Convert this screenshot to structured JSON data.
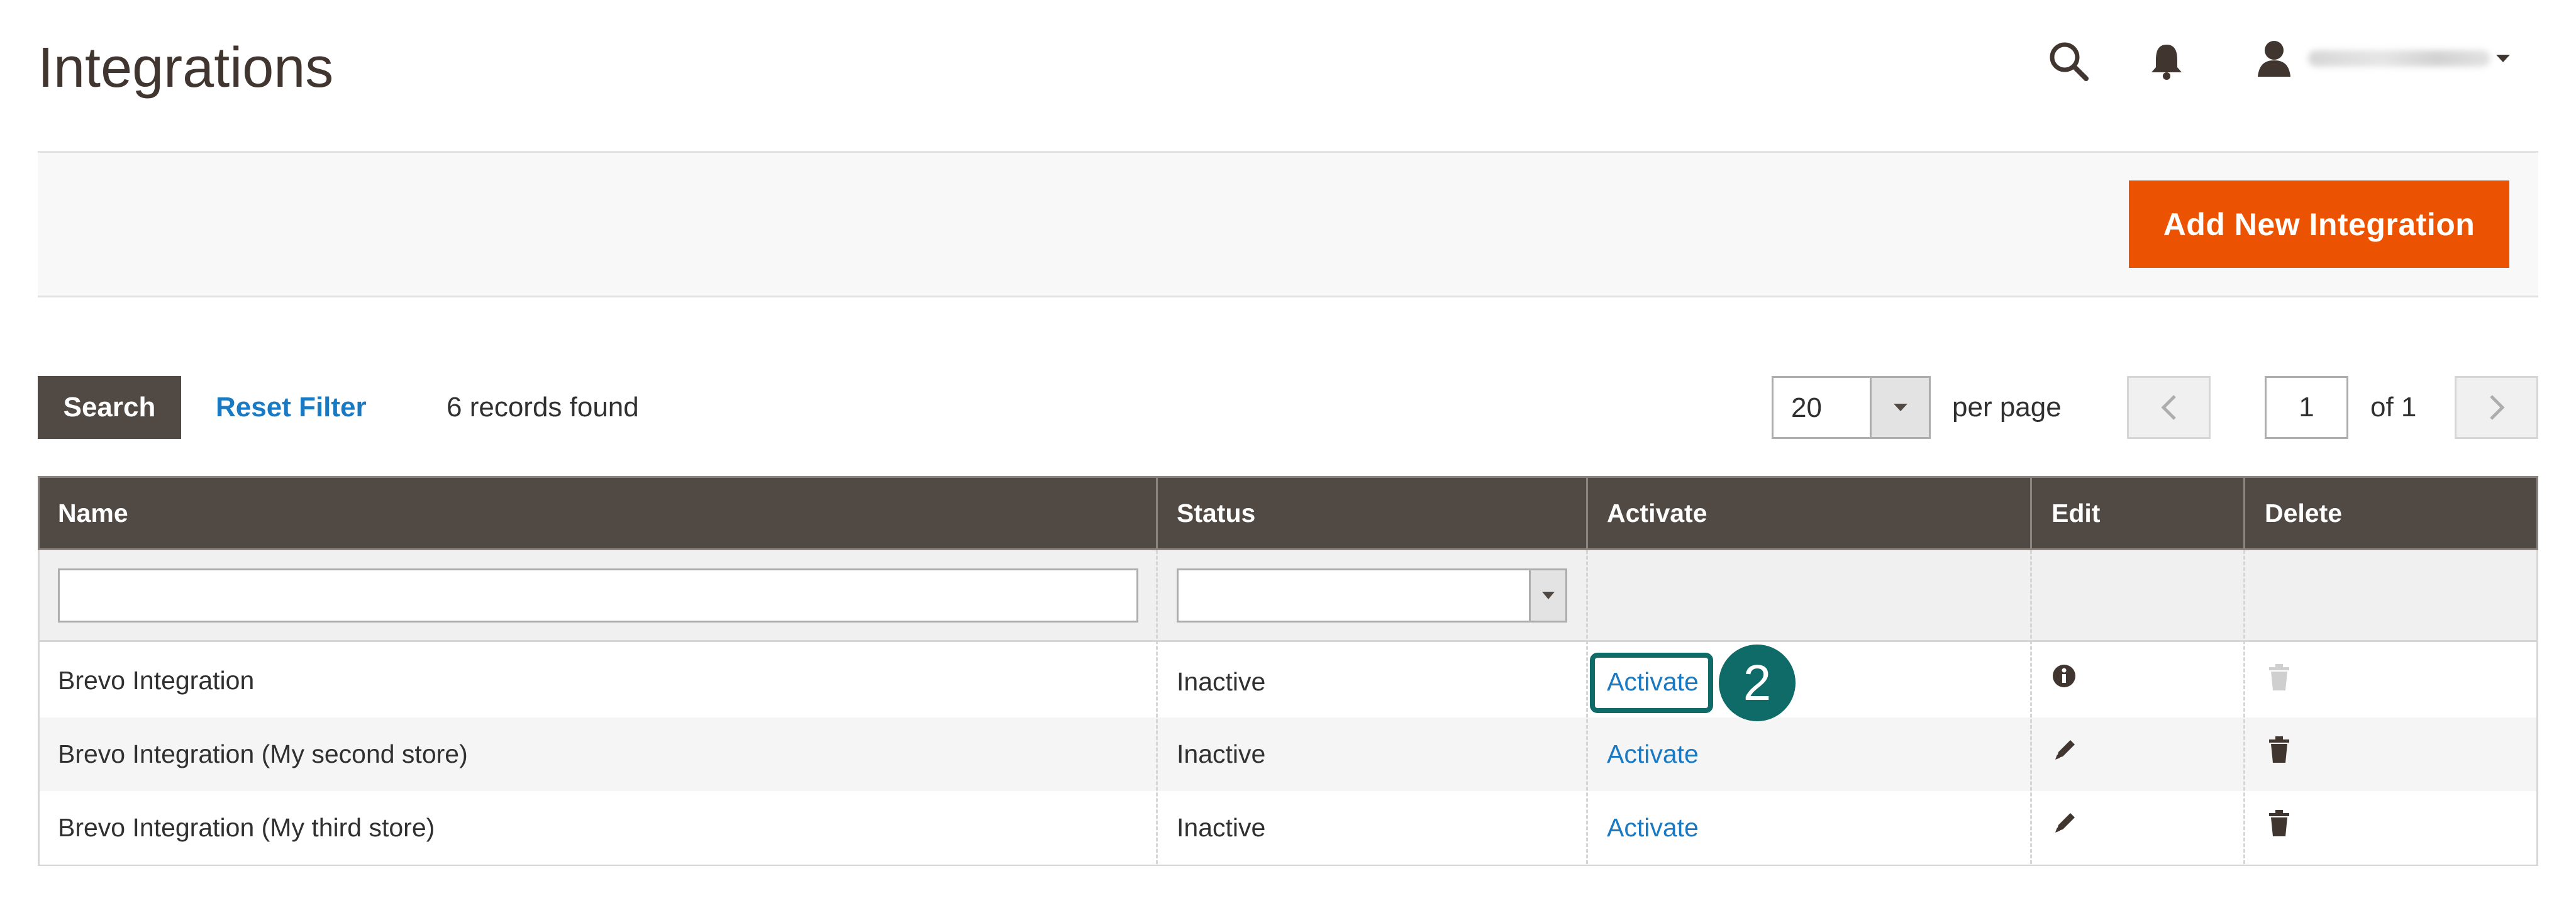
{
  "header": {
    "title": "Integrations",
    "user_name": "magento-admin",
    "icons": {
      "search": "search-icon",
      "notifications": "bell-icon",
      "account": "user-icon",
      "dropdown": "caret-down-icon"
    }
  },
  "actions": {
    "add_new": "Add New Integration"
  },
  "toolbar": {
    "search_label": "Search",
    "reset_label": "Reset Filter",
    "records_found": "6 records found",
    "per_page_value": "20",
    "per_page_label": "per page",
    "current_page": "1",
    "page_total": "of 1"
  },
  "grid": {
    "columns": [
      "Name",
      "Status",
      "Activate",
      "Edit",
      "Delete"
    ],
    "rows": [
      {
        "name": "Brevo Integration",
        "status": "Inactive",
        "activate": "Activate",
        "edit_icon": "info-icon",
        "delete_icon": "trash-icon-disabled"
      },
      {
        "name": "Brevo Integration (My second store)",
        "status": "Inactive",
        "activate": "Activate",
        "edit_icon": "pencil-icon",
        "delete_icon": "trash-icon"
      },
      {
        "name": "Brevo Integration (My third store)",
        "status": "Inactive",
        "activate": "Activate",
        "edit_icon": "pencil-icon",
        "delete_icon": "trash-icon"
      }
    ]
  },
  "callout": {
    "step": "2"
  },
  "colors": {
    "primary_button": "#eb5202",
    "grid_header": "#514943",
    "link": "#1979c3",
    "callout": "#0f6b67"
  }
}
